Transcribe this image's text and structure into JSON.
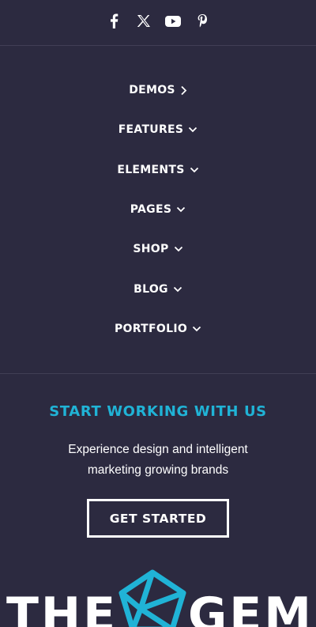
{
  "social": {
    "icons": [
      "facebook-icon",
      "x-icon",
      "youtube-icon",
      "pinterest-icon"
    ]
  },
  "nav": {
    "items": [
      {
        "label": "DEMOS",
        "chevron": "chevron-right-icon"
      },
      {
        "label": "FEATURES",
        "chevron": "chevron-down-icon"
      },
      {
        "label": "ELEMENTS",
        "chevron": "chevron-down-icon"
      },
      {
        "label": "PAGES",
        "chevron": "chevron-down-icon"
      },
      {
        "label": "SHOP",
        "chevron": "chevron-down-icon"
      },
      {
        "label": "BLOG",
        "chevron": "chevron-down-icon"
      },
      {
        "label": "PORTFOLIO",
        "chevron": "chevron-down-icon"
      }
    ]
  },
  "cta": {
    "title": "START WORKING WITH US",
    "text_line1": "Experience design and intelligent",
    "text_line2": "marketing growing brands",
    "button_label": "GET STARTED"
  },
  "logo": {
    "word_left": "THE",
    "word_right": "GEM"
  },
  "colors": {
    "background": "#2c2a40",
    "accent": "#20b3d6",
    "text": "#ffffff",
    "divider": "#413e55"
  }
}
